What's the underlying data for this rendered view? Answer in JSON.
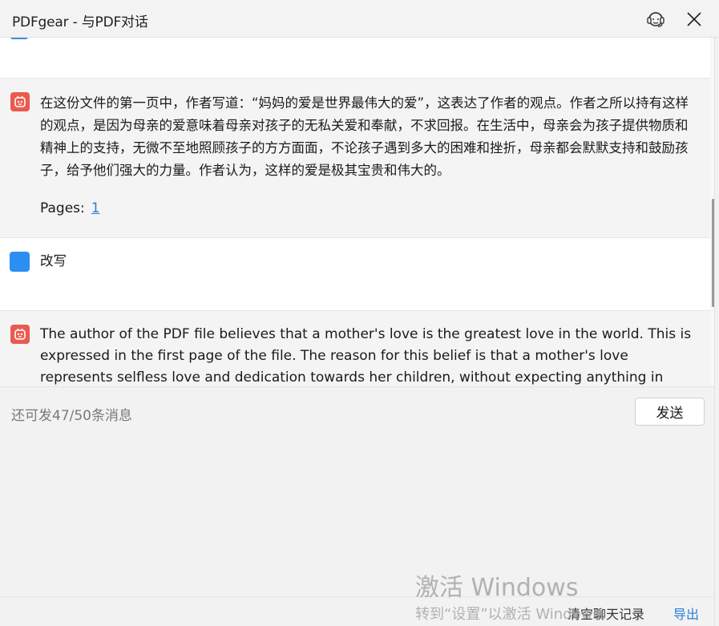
{
  "window": {
    "title": "PDFgear - 与PDF对话",
    "icons": {
      "support": "headset-support-icon",
      "close": "close-icon"
    }
  },
  "chat": {
    "messages": [
      {
        "role": "assistant",
        "text": "在这份文件的第一页中，作者写道：“妈妈的爱是世界最伟大的爱”，这表达了作者的观点。作者之所以持有这样的观点，是因为母亲的爱意味着母亲对孩子的无私关爱和奉献，不求回报。在生活中，母亲会为孩子提供物质和精神上的支持，无微不至地照顾孩子的方方面面，不论孩子遇到多大的困难和挫折，母亲都会默默支持和鼓励孩子，给予他们强大的力量。作者认为，这样的爱是极其宝贵和伟大的。",
        "pages_label": "Pages:",
        "pages": [
          "1"
        ]
      },
      {
        "role": "user",
        "text": "改写"
      },
      {
        "role": "assistant",
        "text": "The author of the PDF file believes that a mother's love is the greatest love in the world. This is expressed in the first page of the file. The reason for this belief is that a mother's love represents selfless love and dedication towards her children, without expecting anything in"
      }
    ]
  },
  "input": {
    "remaining": "还可发47/50条消息",
    "send_label": "发送"
  },
  "footer": {
    "clear_label": "清空聊天记录",
    "export_label": "导出"
  },
  "watermark": {
    "title": "激活 Windows",
    "subtitle": "转到“设置”以激活 Windows。"
  },
  "colors": {
    "bot_avatar": "#ea5a4f",
    "user_avatar": "#2b8ef0",
    "link": "#2a7ed8"
  }
}
